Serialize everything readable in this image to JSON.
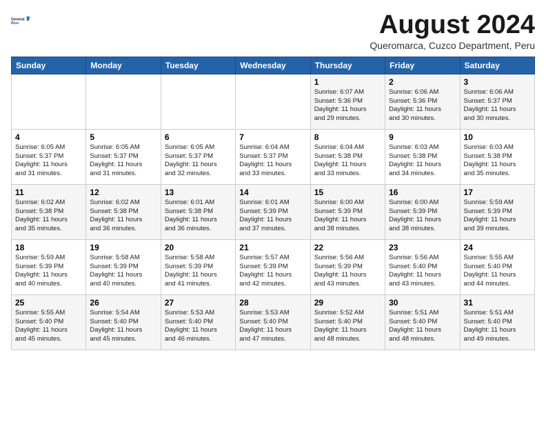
{
  "header": {
    "logo_line1": "General",
    "logo_line2": "Blue",
    "month_title": "August 2024",
    "location": "Queromarca, Cuzco Department, Peru"
  },
  "weekdays": [
    "Sunday",
    "Monday",
    "Tuesday",
    "Wednesday",
    "Thursday",
    "Friday",
    "Saturday"
  ],
  "weeks": [
    [
      {
        "day": "",
        "info": ""
      },
      {
        "day": "",
        "info": ""
      },
      {
        "day": "",
        "info": ""
      },
      {
        "day": "",
        "info": ""
      },
      {
        "day": "1",
        "info": "Sunrise: 6:07 AM\nSunset: 5:36 PM\nDaylight: 11 hours\nand 29 minutes."
      },
      {
        "day": "2",
        "info": "Sunrise: 6:06 AM\nSunset: 5:36 PM\nDaylight: 11 hours\nand 30 minutes."
      },
      {
        "day": "3",
        "info": "Sunrise: 6:06 AM\nSunset: 5:37 PM\nDaylight: 11 hours\nand 30 minutes."
      }
    ],
    [
      {
        "day": "4",
        "info": "Sunrise: 6:05 AM\nSunset: 5:37 PM\nDaylight: 11 hours\nand 31 minutes."
      },
      {
        "day": "5",
        "info": "Sunrise: 6:05 AM\nSunset: 5:37 PM\nDaylight: 11 hours\nand 31 minutes."
      },
      {
        "day": "6",
        "info": "Sunrise: 6:05 AM\nSunset: 5:37 PM\nDaylight: 11 hours\nand 32 minutes."
      },
      {
        "day": "7",
        "info": "Sunrise: 6:04 AM\nSunset: 5:37 PM\nDaylight: 11 hours\nand 33 minutes."
      },
      {
        "day": "8",
        "info": "Sunrise: 6:04 AM\nSunset: 5:38 PM\nDaylight: 11 hours\nand 33 minutes."
      },
      {
        "day": "9",
        "info": "Sunrise: 6:03 AM\nSunset: 5:38 PM\nDaylight: 11 hours\nand 34 minutes."
      },
      {
        "day": "10",
        "info": "Sunrise: 6:03 AM\nSunset: 5:38 PM\nDaylight: 11 hours\nand 35 minutes."
      }
    ],
    [
      {
        "day": "11",
        "info": "Sunrise: 6:02 AM\nSunset: 5:38 PM\nDaylight: 11 hours\nand 35 minutes."
      },
      {
        "day": "12",
        "info": "Sunrise: 6:02 AM\nSunset: 5:38 PM\nDaylight: 11 hours\nand 36 minutes."
      },
      {
        "day": "13",
        "info": "Sunrise: 6:01 AM\nSunset: 5:38 PM\nDaylight: 11 hours\nand 36 minutes."
      },
      {
        "day": "14",
        "info": "Sunrise: 6:01 AM\nSunset: 5:39 PM\nDaylight: 11 hours\nand 37 minutes."
      },
      {
        "day": "15",
        "info": "Sunrise: 6:00 AM\nSunset: 5:39 PM\nDaylight: 11 hours\nand 38 minutes."
      },
      {
        "day": "16",
        "info": "Sunrise: 6:00 AM\nSunset: 5:39 PM\nDaylight: 11 hours\nand 38 minutes."
      },
      {
        "day": "17",
        "info": "Sunrise: 5:59 AM\nSunset: 5:39 PM\nDaylight: 11 hours\nand 39 minutes."
      }
    ],
    [
      {
        "day": "18",
        "info": "Sunrise: 5:59 AM\nSunset: 5:39 PM\nDaylight: 11 hours\nand 40 minutes."
      },
      {
        "day": "19",
        "info": "Sunrise: 5:58 AM\nSunset: 5:39 PM\nDaylight: 11 hours\nand 40 minutes."
      },
      {
        "day": "20",
        "info": "Sunrise: 5:58 AM\nSunset: 5:39 PM\nDaylight: 11 hours\nand 41 minutes."
      },
      {
        "day": "21",
        "info": "Sunrise: 5:57 AM\nSunset: 5:39 PM\nDaylight: 11 hours\nand 42 minutes."
      },
      {
        "day": "22",
        "info": "Sunrise: 5:56 AM\nSunset: 5:39 PM\nDaylight: 11 hours\nand 43 minutes."
      },
      {
        "day": "23",
        "info": "Sunrise: 5:56 AM\nSunset: 5:40 PM\nDaylight: 11 hours\nand 43 minutes."
      },
      {
        "day": "24",
        "info": "Sunrise: 5:55 AM\nSunset: 5:40 PM\nDaylight: 11 hours\nand 44 minutes."
      }
    ],
    [
      {
        "day": "25",
        "info": "Sunrise: 5:55 AM\nSunset: 5:40 PM\nDaylight: 11 hours\nand 45 minutes."
      },
      {
        "day": "26",
        "info": "Sunrise: 5:54 AM\nSunset: 5:40 PM\nDaylight: 11 hours\nand 45 minutes."
      },
      {
        "day": "27",
        "info": "Sunrise: 5:53 AM\nSunset: 5:40 PM\nDaylight: 11 hours\nand 46 minutes."
      },
      {
        "day": "28",
        "info": "Sunrise: 5:53 AM\nSunset: 5:40 PM\nDaylight: 11 hours\nand 47 minutes."
      },
      {
        "day": "29",
        "info": "Sunrise: 5:52 AM\nSunset: 5:40 PM\nDaylight: 11 hours\nand 48 minutes."
      },
      {
        "day": "30",
        "info": "Sunrise: 5:51 AM\nSunset: 5:40 PM\nDaylight: 11 hours\nand 48 minutes."
      },
      {
        "day": "31",
        "info": "Sunrise: 5:51 AM\nSunset: 5:40 PM\nDaylight: 11 hours\nand 49 minutes."
      }
    ]
  ]
}
